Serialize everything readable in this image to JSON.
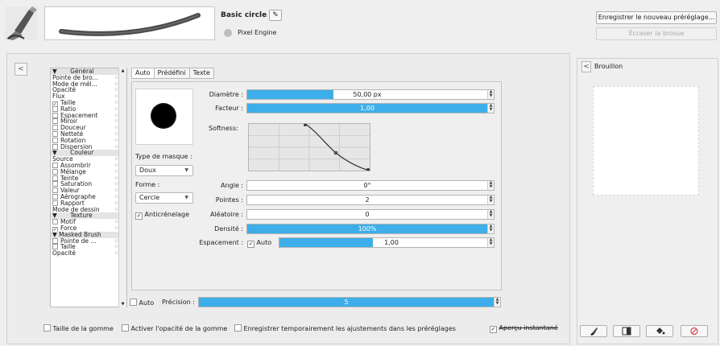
{
  "header": {
    "preset_name": "Basic circle",
    "engine_label": "Pixel Engine",
    "save_new_preset": "Enregistrer le nouveau préréglage...",
    "overwrite_brush": "Écraser la brosse"
  },
  "options": {
    "rows": [
      {
        "label": "Général",
        "type": "group"
      },
      {
        "label": "Pointe de bro...",
        "type": "item"
      },
      {
        "label": "Mode de mél...",
        "type": "item"
      },
      {
        "label": "Opacité",
        "type": "item"
      },
      {
        "label": "Flux",
        "type": "item"
      },
      {
        "label": "Taille",
        "type": "check",
        "checked": true
      },
      {
        "label": "Ratio",
        "type": "check",
        "checked": false
      },
      {
        "label": "Espacement",
        "type": "check",
        "checked": false
      },
      {
        "label": "Miroir",
        "type": "check",
        "checked": false
      },
      {
        "label": "Douceur",
        "type": "check",
        "checked": false
      },
      {
        "label": "Netteté",
        "type": "check",
        "checked": false
      },
      {
        "label": "Rotation",
        "type": "check",
        "checked": false
      },
      {
        "label": "Dispersion",
        "type": "check",
        "checked": false
      },
      {
        "label": "Couleur",
        "type": "group"
      },
      {
        "label": "Source",
        "type": "item"
      },
      {
        "label": "Assombrir",
        "type": "check",
        "checked": false
      },
      {
        "label": "Mélange",
        "type": "check",
        "checked": false
      },
      {
        "label": "Teinte",
        "type": "check",
        "checked": false
      },
      {
        "label": "Saturation",
        "type": "check",
        "checked": false
      },
      {
        "label": "Valeur",
        "type": "check",
        "checked": false
      },
      {
        "label": "Aérographe",
        "type": "check",
        "checked": false
      },
      {
        "label": "Rapport",
        "type": "check",
        "checked": false
      },
      {
        "label": "Mode de dessin",
        "type": "item"
      },
      {
        "label": "Texture",
        "type": "group"
      },
      {
        "label": "Motif",
        "type": "check",
        "checked": false
      },
      {
        "label": "Force",
        "type": "check",
        "checked": true
      },
      {
        "label": "Masked Brush",
        "type": "group2"
      },
      {
        "label": "Pointe de ...",
        "type": "check",
        "checked": false
      },
      {
        "label": "Taille",
        "type": "check",
        "checked": false
      },
      {
        "label": "Opacité",
        "type": "item"
      }
    ]
  },
  "tabs": [
    "Auto",
    "Prédéfini",
    "Texte"
  ],
  "tip": {
    "mask_type_label": "Type de masque :",
    "mask_type_value": "Doux",
    "shape_label": "Forme :",
    "shape_value": "Cercle",
    "antialias_label": "Anticrénelage",
    "diameter_label": "Diamètre :",
    "diameter_value": "50,00 px",
    "diameter_fraction": 0.36,
    "factor_label": "Facteur :",
    "factor_value": "1,00",
    "factor_fraction": 1.0,
    "softness_label": "Softness:",
    "angle_label": "Angle :",
    "angle_value": "0°",
    "spikes_label": "Pointes :",
    "spikes_value": "2",
    "random_label": "Aléatoire :",
    "random_value": "0",
    "density_label": "Densité :",
    "density_value": "100%",
    "density_fraction": 1.0,
    "spacing_label": "Espacement :",
    "spacing_auto": "Auto",
    "spacing_value": "1,00",
    "spacing_fraction": 0.45,
    "precision_auto": "Auto",
    "precision_label": "Précision :",
    "precision_value": "5",
    "precision_fraction": 1.0
  },
  "bottom": {
    "eraser_size": "Taille de la gomme",
    "eraser_opacity": "Activer l'opacité de la gomme",
    "temp_save": "Enregistrer temporairement les ajustements dans les préréglages",
    "instant_preview": "Aperçu instantané"
  },
  "scratchpad": {
    "title": "Brouillon"
  },
  "colors": {
    "accent": "#3daee9"
  }
}
